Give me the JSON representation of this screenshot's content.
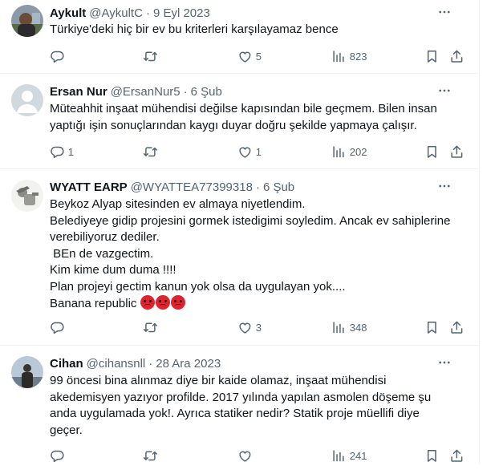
{
  "tweets": [
    {
      "display_name": "Aykult",
      "handle": "@AykultC",
      "separator": "·",
      "date": "9 Eyl 2023",
      "lines": [
        "Türkiye'deki hiç bir ev bu kriterleri karşılayamaz bence"
      ],
      "replies": "",
      "retweets": "",
      "likes": "5",
      "views": "823"
    },
    {
      "display_name": "Ersan Nur",
      "handle": "@ErsanNur5",
      "separator": "·",
      "date": "6 Şub",
      "lines": [
        "Müteahhit inşaat mühendisi değilse kapısından bile geçmem. Bilen insan",
        "yaptığı işin sonuçlarından kaygı duyar doğru şekilde yapmaya çalışır."
      ],
      "replies": "1",
      "retweets": "",
      "likes": "1",
      "views": "202"
    },
    {
      "display_name": "WYATT EARP",
      "handle": "@WYATTEA77399318",
      "separator": "·",
      "date": "6 Şub",
      "lines": [
        "Beykoz Alyap sitesinden ev almaya niyetlendim.",
        "Belediyeye gidip projesini gormek istedigimi soyledim. Ancak ev sahiplerine",
        "verebiliyoruz dediler.",
        " BEn de vazgectim.",
        "Kim kime dum duma !!!!",
        "Plan projeyi gectim kanun yok olsa da uygulayan yok....",
        "Banana republic"
      ],
      "emoji": [
        "angry-face",
        "angry-face",
        "angry-face"
      ],
      "replies": "",
      "retweets": "",
      "likes": "3",
      "views": "348"
    },
    {
      "display_name": "Cihan",
      "handle": "@cihansnll",
      "separator": "·",
      "date": "28 Ara 2023",
      "lines": [
        "99 öncesi bina alınmaz diye bir kaide olamaz, inşaat mühendisi",
        "akedemisyen yazıyor profilde. 2017 yılında yapılan asmolen döşeme şu",
        "anda uygulamada yok!. Ayrıca statiker nedir? Statik proje müellifi diye",
        "geçer."
      ],
      "replies": "",
      "retweets": "",
      "likes": "",
      "views": "241"
    }
  ],
  "icons": {
    "reply": "reply-icon",
    "retweet": "retweet-icon",
    "like": "heart-icon",
    "views": "views-icon",
    "bookmark": "bookmark-icon",
    "share": "share-icon",
    "more": "more-icon"
  },
  "colors": {
    "text": "#0f1419",
    "secondary": "#536471",
    "divider": "#eff3f4"
  }
}
